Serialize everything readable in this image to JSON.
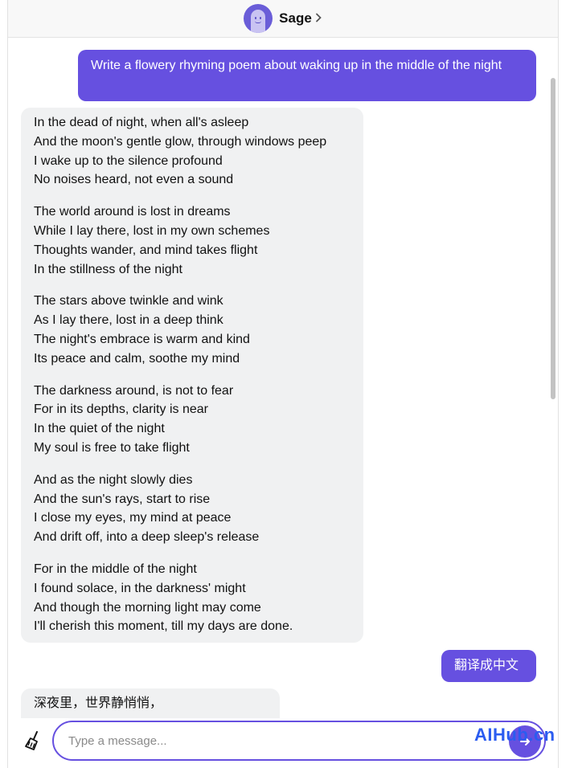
{
  "header": {
    "bot_name": "Sage"
  },
  "messages": {
    "user_1": "Write a flowery rhyming poem about waking up in the middle of the night",
    "poem": [
      [
        "In the dead of night, when all's asleep",
        "And the moon's gentle glow, through windows peep",
        "I wake up to the silence profound",
        "No noises heard, not even a sound"
      ],
      [
        "The world around is lost in dreams",
        "While I lay there, lost in my own schemes",
        "Thoughts wander, and mind takes flight",
        "In the stillness of the night"
      ],
      [
        "The stars above twinkle and wink",
        "As I lay there, lost in a deep think",
        "The night's embrace is warm and kind",
        "Its peace and calm, soothe my mind"
      ],
      [
        "The darkness around, is not to fear",
        "For in its depths, clarity is near",
        "In the quiet of the night",
        "My soul is free to take flight"
      ],
      [
        "And as the night slowly dies",
        "And the sun's rays, start to rise",
        "I close my eyes, my mind at peace",
        "And drift off, into a deep sleep's release"
      ],
      [
        "For in the middle of the night",
        "I found solace, in the darkness' might",
        "And though the morning light may come",
        "I'll cherish this moment, till my days are done."
      ]
    ],
    "user_2": "翻译成中文",
    "bot_partial": "深夜里，世界静悄悄，"
  },
  "composer": {
    "placeholder": "Type a message..."
  },
  "watermark": "AIHub.cn",
  "colors": {
    "accent": "#6650e0",
    "bot_bubble": "#f0f1f2",
    "watermark": "#2b5cf0"
  },
  "icons": {
    "clear": "broom-icon",
    "send": "send-arrow-icon",
    "header_chevron": "chevron-right-icon"
  }
}
